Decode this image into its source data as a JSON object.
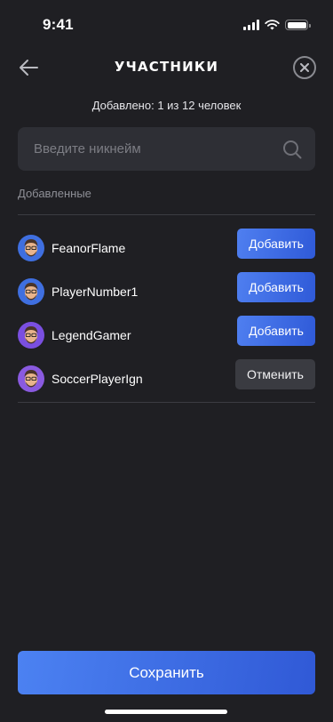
{
  "status_bar": {
    "time": "9:41"
  },
  "header": {
    "title": "УЧАСТНИКИ"
  },
  "counter": {
    "text": "Добавлено: 1 из 12 человек"
  },
  "search": {
    "placeholder": "Введите никнейм",
    "value": ""
  },
  "section": {
    "label": "Добавленные"
  },
  "players": [
    {
      "name": "FeanorFlame",
      "button": "Добавить",
      "action": "add",
      "avatar_color": "#3f6fe0"
    },
    {
      "name": "PlayerNumber1",
      "button": "Добавить",
      "action": "add",
      "avatar_color": "#3f6fe0"
    },
    {
      "name": "LegendGamer",
      "button": "Добавить",
      "action": "add",
      "avatar_color": "#7a4fe0"
    },
    {
      "name": "SoccerPlayerIgn",
      "button": "Отменить",
      "action": "cancel",
      "avatar_color": "#8a5ae0"
    }
  ],
  "footer": {
    "save_label": "Сохранить"
  },
  "colors": {
    "background": "#1f1f23",
    "accent": "#3f6fe0",
    "field": "#2e2f35",
    "cancel_button": "#3a3b41"
  }
}
